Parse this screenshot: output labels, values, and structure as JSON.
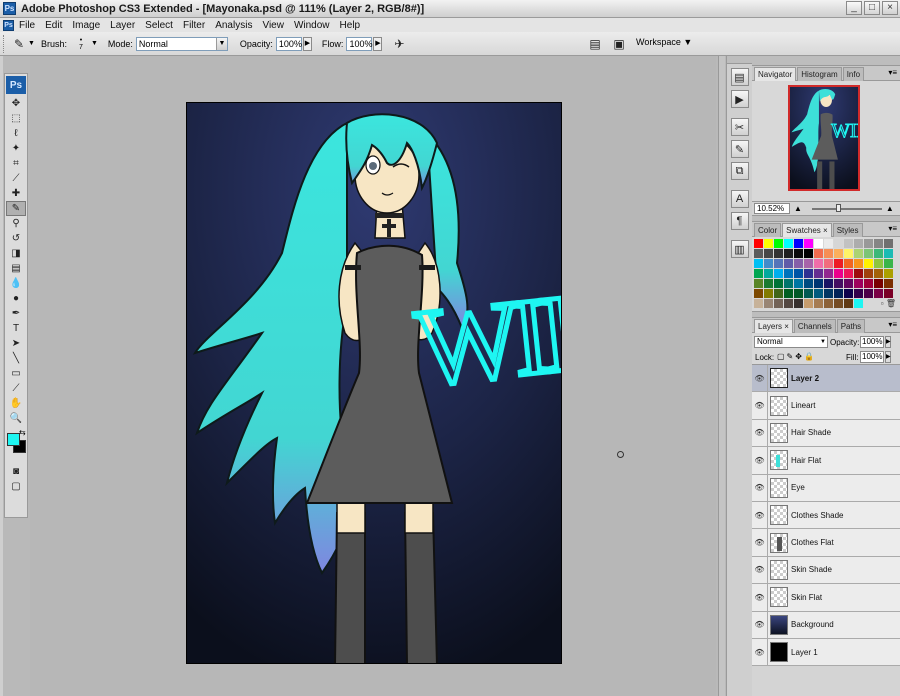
{
  "window": {
    "title": "Adobe Photoshop CS3 Extended - [Mayonaka.psd @ 111% (Layer 2, RGB/8#)]",
    "app_icon_label": "Ps",
    "minimize": "_",
    "maximize": "□",
    "close": "×"
  },
  "menu": [
    "File",
    "Edit",
    "Image",
    "Layer",
    "Select",
    "Filter",
    "Analysis",
    "View",
    "Window",
    "Help"
  ],
  "options_bar": {
    "brush_label": "Brush:",
    "brush_size": "7",
    "mode_label": "Mode:",
    "mode_value": "Normal",
    "opacity_label": "Opacity:",
    "opacity_value": "100%",
    "flow_label": "Flow:",
    "flow_value": "100%",
    "workspace_label": "Workspace ▼"
  },
  "toolbox": {
    "header": "Ps",
    "tools": [
      {
        "name": "move-tool",
        "glyph": "✥"
      },
      {
        "name": "marquee-tool",
        "glyph": "⬚"
      },
      {
        "name": "lasso-tool",
        "glyph": "ℓ"
      },
      {
        "name": "magic-wand-tool",
        "glyph": "✦"
      },
      {
        "name": "crop-tool",
        "glyph": "⌗"
      },
      {
        "name": "eyedropper-slice-tool",
        "glyph": "⟋"
      },
      {
        "name": "healing-brush-tool",
        "glyph": "✚"
      },
      {
        "name": "brush-tool",
        "glyph": "✎",
        "active": true
      },
      {
        "name": "clone-stamp-tool",
        "glyph": "⚲"
      },
      {
        "name": "history-brush-tool",
        "glyph": "↺"
      },
      {
        "name": "eraser-tool",
        "glyph": "◨"
      },
      {
        "name": "gradient-tool",
        "glyph": "▤"
      },
      {
        "name": "blur-tool",
        "glyph": "💧"
      },
      {
        "name": "dodge-tool",
        "glyph": "●"
      },
      {
        "name": "pen-tool",
        "glyph": "✒"
      },
      {
        "name": "type-tool",
        "glyph": "T"
      },
      {
        "name": "path-selection-tool",
        "glyph": "➤"
      },
      {
        "name": "line-tool",
        "glyph": "╲"
      },
      {
        "name": "notes-tool",
        "glyph": "▭"
      },
      {
        "name": "eyedropper-tool",
        "glyph": "⟋"
      },
      {
        "name": "hand-tool",
        "glyph": "✋"
      },
      {
        "name": "zoom-tool",
        "glyph": "🔍"
      }
    ],
    "foreground_color": "#1ef6f2",
    "background_color": "#000000",
    "quick_mask_glyph": "◙",
    "screen_mode_glyph": "▢"
  },
  "dock_icons": [
    {
      "name": "history-icon",
      "glyph": "▤"
    },
    {
      "name": "actions-icon",
      "glyph": "▶"
    },
    {
      "name": "tool-presets-icon",
      "glyph": "✂"
    },
    {
      "name": "brushes-icon",
      "glyph": "✎"
    },
    {
      "name": "clone-source-icon",
      "glyph": "⧉"
    },
    {
      "name": "character-icon",
      "glyph": "A"
    },
    {
      "name": "paragraph-icon",
      "glyph": "¶"
    },
    {
      "name": "layer-comps-icon",
      "glyph": "▥"
    }
  ],
  "navigator": {
    "tabs": [
      "Navigator",
      "Histogram",
      "Info"
    ],
    "zoom_value": "10.52%"
  },
  "swatches": {
    "tabs": [
      "Color",
      "Swatches ×",
      "Styles"
    ],
    "colors": [
      "#ff0000",
      "#ffff00",
      "#00ff00",
      "#00ffff",
      "#0000ff",
      "#ff00ff",
      "#ffffff",
      "#ebebeb",
      "#d6d6d6",
      "#c2c2c2",
      "#adadad",
      "#999999",
      "#858585",
      "#707070",
      "#5c5c5c",
      "#474747",
      "#333333",
      "#1f1f1f",
      "#0a0a0a",
      "#000000",
      "#f26c4f",
      "#f68e55",
      "#fbaf5c",
      "#fff467",
      "#acd372",
      "#7cc576",
      "#3bb878",
      "#1abbb4",
      "#00bff3",
      "#438ccb",
      "#5574b9",
      "#605ca8",
      "#855fa8",
      "#a763a9",
      "#f06ea9",
      "#f26d7d",
      "#ed1c24",
      "#f26522",
      "#f7941d",
      "#fff200",
      "#8dc63f",
      "#39b54a",
      "#00a651",
      "#00a99d",
      "#00aeef",
      "#0072bc",
      "#0054a6",
      "#2e3192",
      "#662d91",
      "#92278f",
      "#ec008c",
      "#ed145b",
      "#9e0b0f",
      "#a0410d",
      "#a36209",
      "#aba000",
      "#598527",
      "#1a7b30",
      "#007236",
      "#00746b",
      "#0076a3",
      "#004b80",
      "#003471",
      "#1b1464",
      "#440e62",
      "#630460",
      "#9e005d",
      "#9e0039",
      "#790000",
      "#7b2e00",
      "#7d4900",
      "#827b00",
      "#406618",
      "#005e20",
      "#005826",
      "#005952",
      "#005b7f",
      "#003663",
      "#002157",
      "#0d004c",
      "#32004b",
      "#4b0049",
      "#7b0046",
      "#7a0026",
      "#c7b299",
      "#998675",
      "#736357",
      "#534741",
      "#37302d",
      "#c69c6d",
      "#a67c52",
      "#8c6239",
      "#754c24",
      "#603913",
      "#1ef6f2"
    ]
  },
  "layers": {
    "tabs": [
      "Layers ×",
      "Channels",
      "Paths"
    ],
    "blend_mode": "Normal",
    "opacity_label": "Opacity:",
    "opacity_value": "100%",
    "lock_label": "Lock:",
    "fill_label": "Fill:",
    "fill_value": "100%",
    "items": [
      {
        "name": "Layer 2",
        "selected": true,
        "thumb": "transparent"
      },
      {
        "name": "Lineart",
        "selected": false,
        "thumb": "transparent"
      },
      {
        "name": "Hair Shade",
        "selected": false,
        "thumb": "transparent"
      },
      {
        "name": "Hair Flat",
        "selected": false,
        "thumb": "cyan"
      },
      {
        "name": "Eye",
        "selected": false,
        "thumb": "transparent"
      },
      {
        "name": "Clothes Shade",
        "selected": false,
        "thumb": "transparent"
      },
      {
        "name": "Clothes Flat",
        "selected": false,
        "thumb": "figure"
      },
      {
        "name": "Skin Shade",
        "selected": false,
        "thumb": "transparent"
      },
      {
        "name": "Skin Flat",
        "selected": false,
        "thumb": "transparent"
      },
      {
        "name": "Background",
        "selected": false,
        "thumb": "gradient"
      },
      {
        "name": "Layer 1",
        "selected": false,
        "thumb": "black"
      }
    ]
  },
  "canvas": {
    "overlay_text": "WIP",
    "background_top": "#2a3466",
    "background_bottom": "#0e1322",
    "hair_color": "#3de0d9",
    "dress_color": "#5c5c5c",
    "skin_color": "#f7e6c4",
    "text_color": "#1ef6f2"
  }
}
